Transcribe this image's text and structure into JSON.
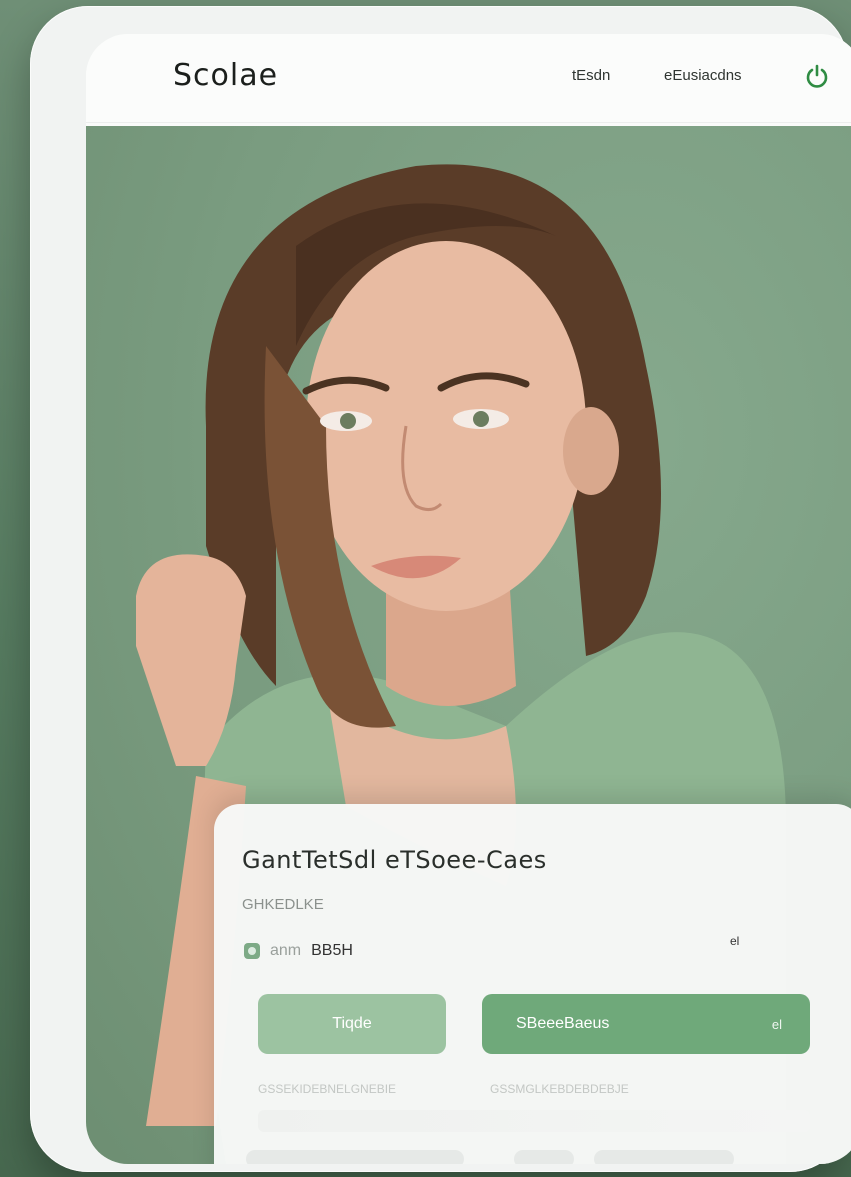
{
  "header": {
    "brand": "Scolae",
    "nav": [
      "tEsdn",
      "eEusiacdns"
    ],
    "icon": "power-icon"
  },
  "hero": {
    "image": "woman-portrait-photo"
  },
  "card": {
    "title": "GantTetSdl eTSoee-Caes",
    "subtitle": "GHKEDLKE",
    "meta_muted": "anm",
    "meta_strong": "BB5H",
    "dot": "el",
    "primary_button": "Tiqde",
    "secondary_button": "SBeeeBaeus",
    "secondary_trail": "el",
    "fine_left": "GSSEKIDEBNELGNEBIE",
    "fine_right": "GSSMGLKEBDEBDEBJE"
  },
  "colors": {
    "background": "#6f8f76",
    "accent": "#6fa97a",
    "accent_light": "#9cc3a1"
  }
}
